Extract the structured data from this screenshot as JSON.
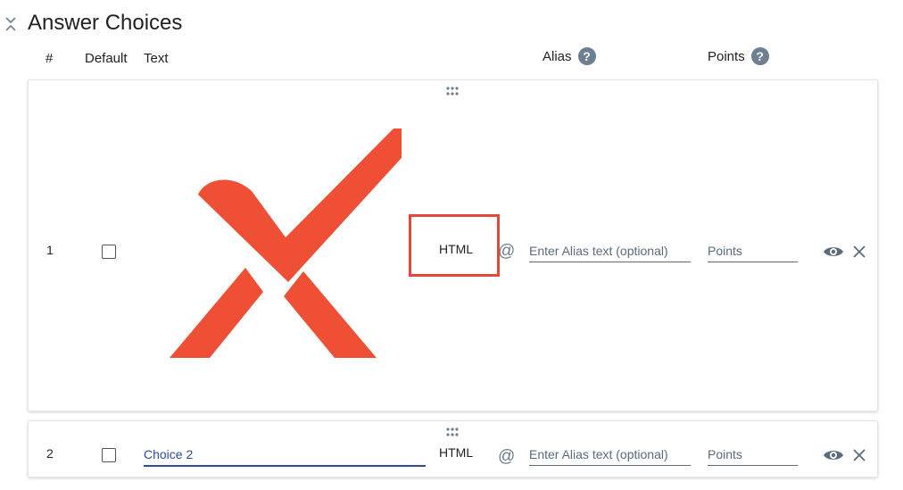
{
  "section": {
    "title": "Answer Choices"
  },
  "headers": {
    "num": "#",
    "default": "Default",
    "text": "Text",
    "alias": "Alias",
    "points": "Points",
    "help_glyph": "?"
  },
  "choices": [
    {
      "number": "1",
      "html_label": "HTML",
      "alias_placeholder": "Enter Alias text (optional)",
      "points_placeholder": "Points"
    },
    {
      "number": "2",
      "text_value": "Choice 2",
      "html_label": "HTML",
      "alias_placeholder": "Enter Alias text (optional)",
      "points_placeholder": "Points"
    }
  ],
  "icons": {
    "at_glyph": "@"
  },
  "colors": {
    "logo": "#ef4f35",
    "highlight": "#e2483b",
    "accent": "#324a9c",
    "muted": "#6d7f91"
  }
}
